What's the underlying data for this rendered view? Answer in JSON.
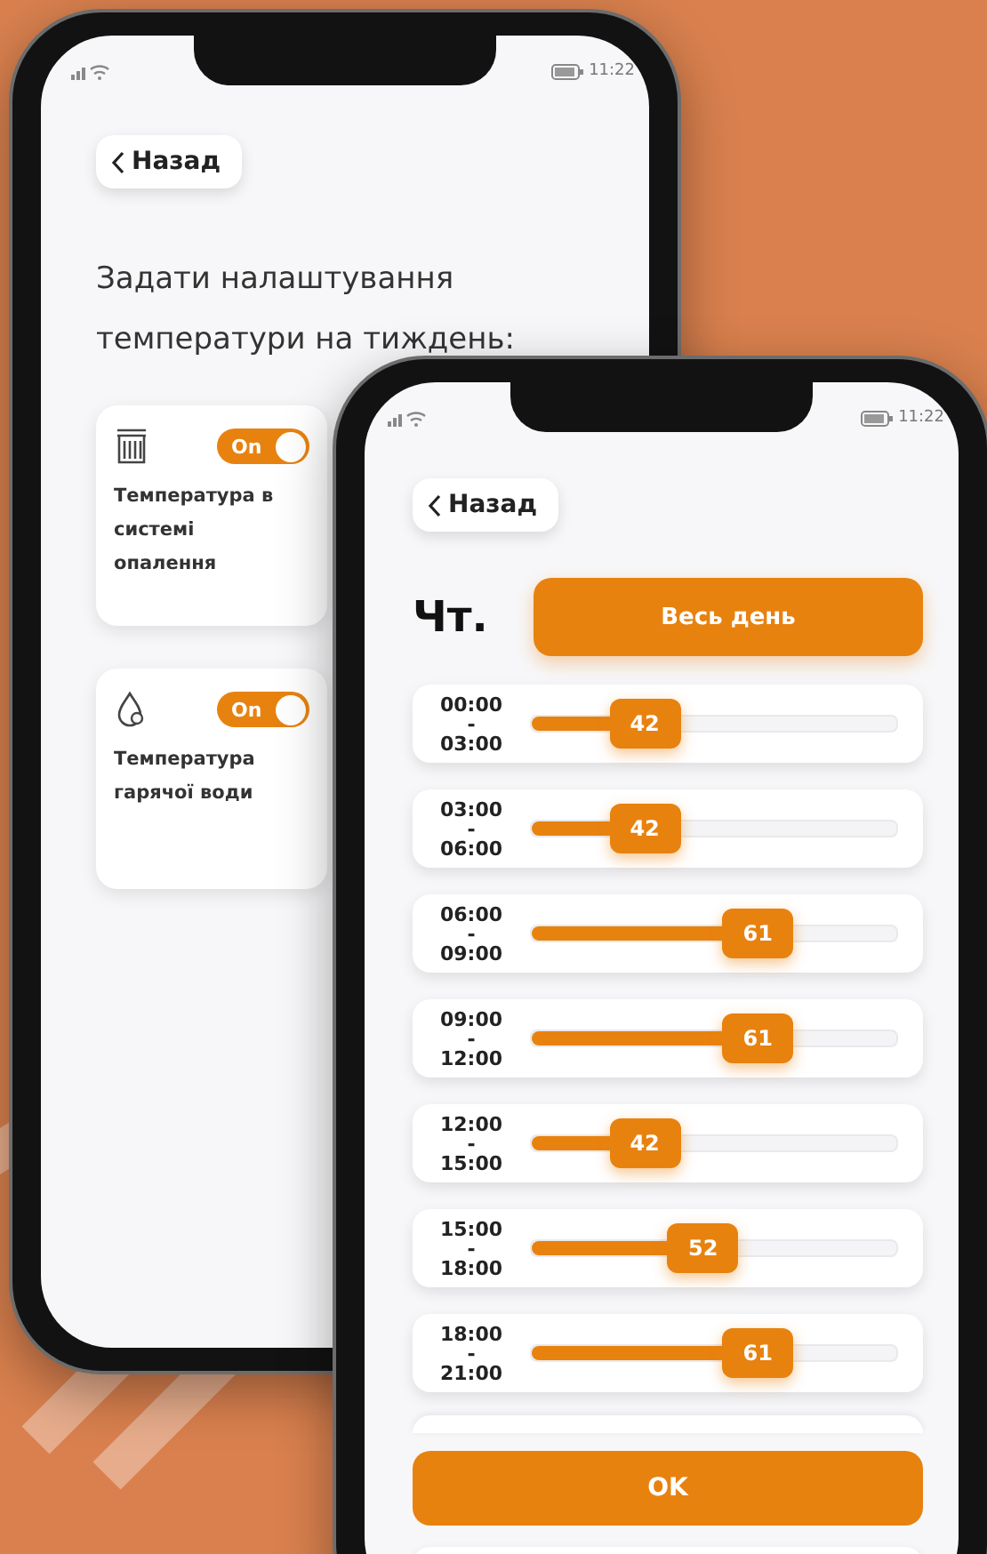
{
  "back_phone": {
    "status_bar": {
      "time": "11:22"
    },
    "back_button": "Назад",
    "title": "Задати налаштування температури на тиждень:",
    "cards": [
      {
        "kind": "heating",
        "toggle_label": "On",
        "on": true,
        "label": "Температура в системі опалення"
      },
      {
        "kind": "water",
        "toggle_label": "On",
        "on": true,
        "label": "Температура гарячої води"
      }
    ]
  },
  "front_phone": {
    "status_bar": {
      "time": "11:22"
    },
    "back_button": "Назад",
    "day": "Чт.",
    "all_day_button": "Весь день",
    "rows": [
      {
        "start": "00:00",
        "separator": "-",
        "end": "03:00",
        "value": "42",
        "level": 0.31
      },
      {
        "start": "03:00",
        "separator": "-",
        "end": "06:00",
        "value": "42",
        "level": 0.31
      },
      {
        "start": "06:00",
        "separator": "-",
        "end": "09:00",
        "value": "61",
        "level": 0.62
      },
      {
        "start": "09:00",
        "separator": "-",
        "end": "12:00",
        "value": "61",
        "level": 0.62
      },
      {
        "start": "12:00",
        "separator": "-",
        "end": "15:00",
        "value": "42",
        "level": 0.31
      },
      {
        "start": "15:00",
        "separator": "-",
        "end": "18:00",
        "value": "52",
        "level": 0.47
      },
      {
        "start": "18:00",
        "separator": "-",
        "end": "21:00",
        "value": "61",
        "level": 0.62
      }
    ],
    "ok_button": "OK"
  }
}
